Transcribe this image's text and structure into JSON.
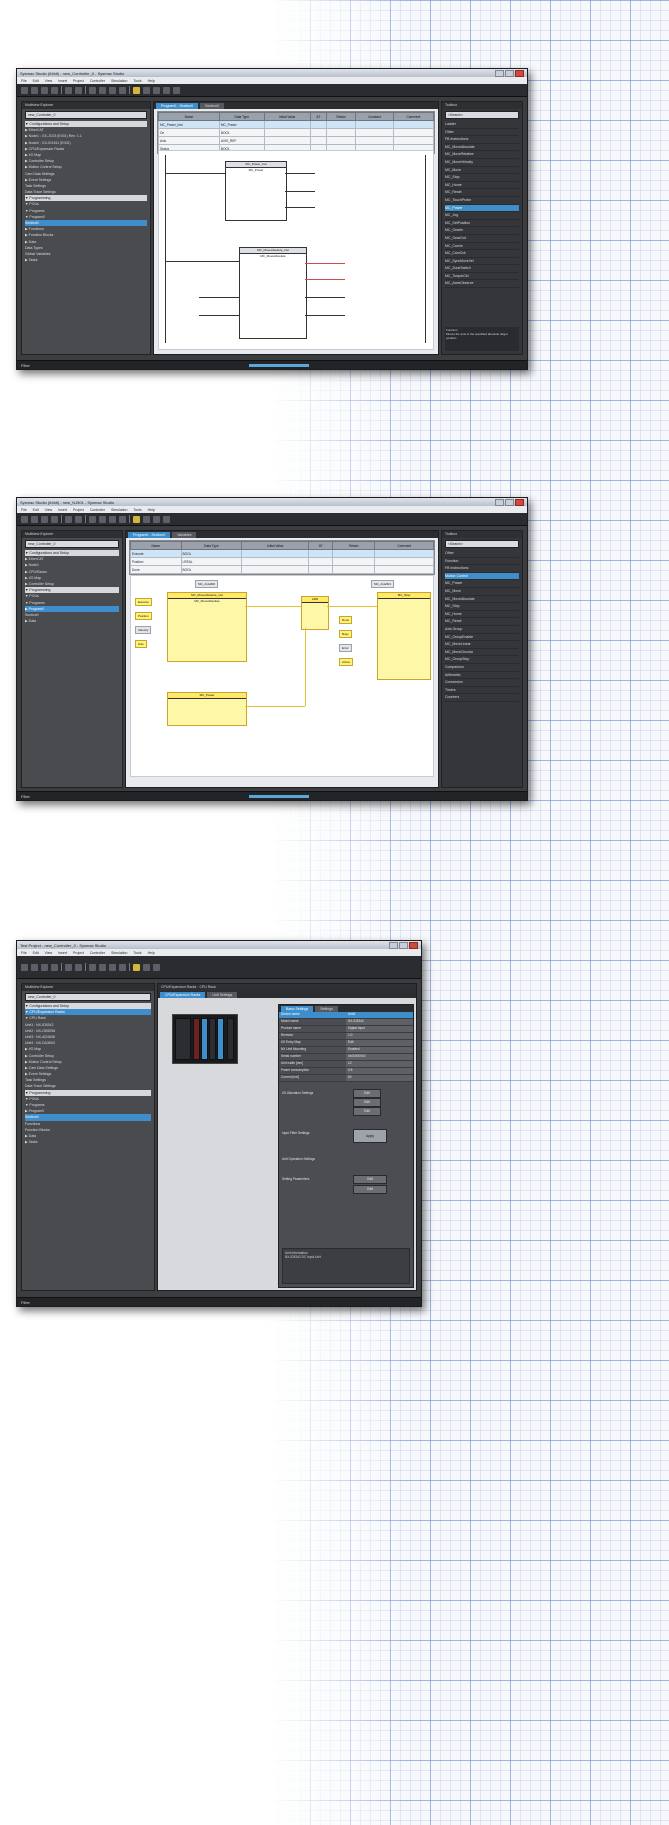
{
  "screens": [
    {
      "title": "Sysmac Studio (64bit) - new_Controller_0 - Sysmac Studio",
      "menu": [
        "File",
        "Edit",
        "View",
        "Insert",
        "Project",
        "Controller",
        "Simulation",
        "Tools",
        "Help"
      ],
      "left_pane": {
        "header": "Multiview Explorer",
        "combo": "new_Controller_0",
        "items": [
          {
            "label": "▼ Configurations and Setup",
            "cls": "sec"
          },
          {
            "label": "  ▶ EtherCAT",
            "cls": ""
          },
          {
            "label": "    ▶ Node1 : GX-JC03 (E001) Rev: 1.1",
            "cls": ""
          },
          {
            "label": "    ▶ Node2 : GX-ID1611 (E002)",
            "cls": ""
          },
          {
            "label": "  ▶ CPU/Expansion Racks",
            "cls": ""
          },
          {
            "label": "  ▶ I/O Map",
            "cls": ""
          },
          {
            "label": "  ▶ Controller Setup",
            "cls": ""
          },
          {
            "label": "  ▶ Motion Control Setup",
            "cls": ""
          },
          {
            "label": "    Cam Data Settings",
            "cls": ""
          },
          {
            "label": "  ▶ Event Settings",
            "cls": ""
          },
          {
            "label": "    Task Settings",
            "cls": ""
          },
          {
            "label": "    Data Trace Settings",
            "cls": ""
          },
          {
            "label": "▼ Programming",
            "cls": "sec"
          },
          {
            "label": "  ▼ POUs",
            "cls": ""
          },
          {
            "label": "    ▼ Programs",
            "cls": ""
          },
          {
            "label": "      ▼ Program0",
            "cls": ""
          },
          {
            "label": "        Section0",
            "cls": "sel"
          },
          {
            "label": "      ▶ Functions",
            "cls": ""
          },
          {
            "label": "      ▶ Function Blocks",
            "cls": ""
          },
          {
            "label": "  ▶ Data",
            "cls": ""
          },
          {
            "label": "    Data Types",
            "cls": ""
          },
          {
            "label": "    Global Variables",
            "cls": ""
          },
          {
            "label": "  ▶ Tasks",
            "cls": ""
          }
        ]
      },
      "editor_tabs": [
        "Program0 - Section0",
        "Section0"
      ],
      "table_headers": [
        "Name",
        "Data Type",
        "Initial Value",
        "AT",
        "Retain",
        "Constant",
        "Comment"
      ],
      "table_rows": [
        [
          "MC_Power_inst",
          "MC_Power",
          "",
          "",
          "",
          "",
          ""
        ],
        [
          "On",
          "BOOL",
          "",
          "",
          "",
          "",
          ""
        ],
        [
          "Axis",
          "AXIS_REF",
          "",
          "",
          "",
          "",
          ""
        ],
        [
          "Status",
          "BOOL",
          "",
          "",
          "",
          "",
          ""
        ]
      ],
      "fb1_title": "MC_Power_inst",
      "fb1_name": "MC_Power",
      "fb2_title": "MC_MoveAbsolute_inst",
      "fb2_name": "MC_MoveAbsolute",
      "toolbox": {
        "header": "Toolbox",
        "search": "<Search>",
        "items": [
          "Ladder",
          "Other",
          "FB Instructions",
          "MC_MoveAbsolute",
          "MC_MoveRelative",
          "MC_MoveVelocity",
          "MC_Move",
          "MC_Stop",
          "MC_Home",
          "MC_Reset",
          "MC_TouchProbe",
          "MC_Power",
          "MC_Jog",
          "MC_SetPosition",
          "MC_GearIn",
          "MC_GearOut",
          "MC_CamIn",
          "MC_CamOut",
          "MC_SyncMoveVel",
          "MC_ZoneSwitch",
          "MC_TorqueCtrl",
          "MC_AxesObserve"
        ],
        "selected_index": 11,
        "help_title": "Function",
        "help_text": "Moves the axis to the specified absolute target position."
      },
      "status_left": "Filter"
    },
    {
      "title": "Sysmac Studio (64bit) - new_NJ501 - Sysmac Studio",
      "menu": [
        "File",
        "Edit",
        "View",
        "Insert",
        "Project",
        "Controller",
        "Simulation",
        "Tools",
        "Help"
      ],
      "left_pane": {
        "header": "Multiview Explorer",
        "combo": "new_Controller_0",
        "items": [
          {
            "label": "▼ Configurations and Setup",
            "cls": "sec"
          },
          {
            "label": "  ▶ EtherCAT",
            "cls": ""
          },
          {
            "label": "    ▶ Node1",
            "cls": ""
          },
          {
            "label": "    ▶ CPU/Racks",
            "cls": ""
          },
          {
            "label": "    ▶ I/O Map",
            "cls": ""
          },
          {
            "label": "  ▶ Controller Setup",
            "cls": ""
          },
          {
            "label": "▼ Programming",
            "cls": "sec"
          },
          {
            "label": "  ▼ POUs",
            "cls": ""
          },
          {
            "label": "    ▼ Programs",
            "cls": ""
          },
          {
            "label": "      ▶ Program0",
            "cls": "sel"
          },
          {
            "label": "        Section0",
            "cls": ""
          },
          {
            "label": "  ▶ Data",
            "cls": ""
          }
        ]
      },
      "editor_tabs": [
        "Program0 - Section0",
        "Variables"
      ],
      "table_headers": [
        "Name",
        "Data Type",
        "Initial Value",
        "AT",
        "Retain",
        "Comment"
      ],
      "table_rows": [
        [
          "Execute",
          "BOOL",
          "",
          "",
          "",
          ""
        ],
        [
          "Position",
          "LREAL",
          "",
          "",
          "",
          ""
        ],
        [
          "Done",
          "BOOL",
          "",
          "",
          "",
          ""
        ]
      ],
      "fbd": {
        "block1_title": "MC_MoveAbsolute_inst",
        "block1_name": "MC_MoveAbsolute",
        "block2_title": "MC_Power",
        "block3_name": "ADD",
        "block4_title": "MC_Stop",
        "labels_left": [
          "Execute",
          "Position",
          "Velocity",
          "Axis"
        ],
        "labels_right": [
          "Done",
          "Busy",
          "Error",
          "Active"
        ],
        "heading1": "MC_Axis000",
        "heading2": "MC_Axis001"
      },
      "toolbox": {
        "header": "Toolbox",
        "search": "<Search>",
        "items": [
          "Other",
          "Function",
          "FB Instructions",
          "Motion Control",
          "MC_Power",
          "MC_Move",
          "MC_MoveAbsolute",
          "MC_Stop",
          "MC_Home",
          "MC_Reset",
          "Axis Group",
          "MC_GroupEnable",
          "MC_MoveLinear",
          "MC_MoveCircular",
          "MC_GroupStop",
          "Comparison",
          "Arithmetic",
          "Conversion",
          "Timers",
          "Counters"
        ],
        "selected_index": 3
      },
      "status_left": "Filter"
    },
    {
      "title": "Test Project - new_Controller_0 - Sysmac Studio",
      "menu": [
        "File",
        "Edit",
        "View",
        "Insert",
        "Project",
        "Controller",
        "Simulation",
        "Tools",
        "Help"
      ],
      "left_pane": {
        "header": "Multiview Explorer",
        "combo": "new_Controller_0",
        "items": [
          {
            "label": "▼ Configurations and Setup",
            "cls": "sec"
          },
          {
            "label": "  ▼ CPU/Expansion Racks",
            "cls": "sel"
          },
          {
            "label": "    ▼ CPU Rack",
            "cls": ""
          },
          {
            "label": "      Unit1 : NX-ID5342",
            "cls": ""
          },
          {
            "label": "      Unit2 : NX-OD5256",
            "cls": ""
          },
          {
            "label": "      Unit3 : NX-AD4608",
            "cls": ""
          },
          {
            "label": "      Unit4 : NX-DA3603",
            "cls": ""
          },
          {
            "label": "  ▶ I/O Map",
            "cls": ""
          },
          {
            "label": "  ▶ Controller Setup",
            "cls": ""
          },
          {
            "label": "  ▶ Motion Control Setup",
            "cls": ""
          },
          {
            "label": "  ▶ Cam Data Settings",
            "cls": ""
          },
          {
            "label": "  ▶ Event Settings",
            "cls": ""
          },
          {
            "label": "    Task Settings",
            "cls": ""
          },
          {
            "label": "    Data Trace Settings",
            "cls": ""
          },
          {
            "label": "▼ Programming",
            "cls": "sec"
          },
          {
            "label": "  ▼ POUs",
            "cls": ""
          },
          {
            "label": "    ▼ Programs",
            "cls": ""
          },
          {
            "label": "      ▶ Program0",
            "cls": ""
          },
          {
            "label": "        Section0",
            "cls": "sel"
          },
          {
            "label": "      Functions",
            "cls": ""
          },
          {
            "label": "      Function Blocks",
            "cls": ""
          },
          {
            "label": "  ▶ Data",
            "cls": ""
          },
          {
            "label": "  ▶ Tasks",
            "cls": ""
          }
        ]
      },
      "editor_title": "CPU/Expansion Racks · CPU Rack",
      "editor_tabs": [
        "CPU/Expansion Racks",
        "Unit Settings"
      ],
      "properties": {
        "tabs": [
          "Basic Settings",
          "Settings"
        ],
        "rows": [
          [
            "Device name",
            "Unit1"
          ],
          [
            "Model name",
            "NX-ID5342"
          ],
          [
            "Product name",
            "Digital Input"
          ],
          [
            "Revision",
            "1.0"
          ],
          [
            "I/O Entry Map",
            "Edit"
          ],
          [
            "NX Unit Mounting",
            "Enabled"
          ],
          [
            "Serial number",
            "0x00000000"
          ],
          [
            "Unit width [mm]",
            "12"
          ],
          [
            "Power consumption",
            "0.8"
          ],
          [
            "Current [mA]",
            "50"
          ]
        ],
        "group1_label": "I/O Allocation Settings",
        "group2_label": "Input Filter Settings",
        "group3_label": "Unit Operation Settings",
        "group4_label": "Setting Parameters",
        "btn_edit": "Edit",
        "btn_apply": "Apply",
        "footer_title": "Unit Information",
        "footer_text": "NX-ID5342 DC Input Unit"
      },
      "status_left": "Filter"
    }
  ]
}
